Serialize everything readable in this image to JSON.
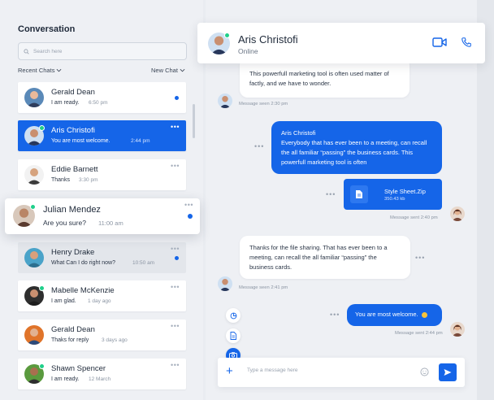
{
  "sidebar": {
    "title": "Conversation",
    "search_placeholder": "Search here",
    "filter_left": "Recent Chats",
    "filter_right": "New Chat",
    "chats": [
      {
        "name": "Gerald Dean",
        "message": "I am ready.",
        "time": "6:50 pm",
        "unread": true
      },
      {
        "name": "Aris Christofi",
        "message": "You are most welcome.",
        "time": "2:44 pm",
        "unread": false
      },
      {
        "name": "Eddie Barnett",
        "message": "Thanks",
        "time": "3:30 pm",
        "unread": false
      },
      {
        "name": "Julian Mendez",
        "message": "Are you sure?",
        "time": "11:00 am",
        "unread": true
      },
      {
        "name": "Henry Drake",
        "message": "What Can I do right now?",
        "time": "10:50 am",
        "unread": true
      },
      {
        "name": "Mabelle McKenzie",
        "message": "I am glad.",
        "time": "1 day ago",
        "unread": false
      },
      {
        "name": "Gerald Dean",
        "message": "Thaks for reply",
        "time": "3 days ago",
        "unread": false
      },
      {
        "name": "Shawn Spencer",
        "message": "I am ready.",
        "time": "12 March",
        "unread": false
      }
    ],
    "more_dots": "•••"
  },
  "header": {
    "name": "Aris Christofi",
    "status": "Online"
  },
  "messages": {
    "m1_text": "This powerfull marketing tool is often used matter of factly, and we have to wonder.",
    "m1_meta": "Message seen 2:30 pm",
    "m2_sender": "Aris Christofi",
    "m2_text": "Everybody that has ever been to a meeting, can recall the all familiar “passing” the business cards. This powerfull marketing tool is often",
    "file_name": "Style Sheet.Zip",
    "file_size": "350.43 kb",
    "m3_meta": "Message sent 2:40 pm",
    "m4_text": "Thanks for the file sharing. That has ever been to a meeting, can recall the all familiar “passing” the business cards.",
    "m4_meta": "Message seen 2:41 pm",
    "m5_text": "You are most welcome.",
    "m5_meta": "Message sent 2:44 pm",
    "dots": "•••"
  },
  "composer": {
    "placeholder": "Type a message here",
    "plus": "+"
  },
  "colors": {
    "accent": "#1565e8",
    "online": "#1fcf8a",
    "background": "#eef0f4"
  },
  "icons": [
    "search-icon",
    "chevron-down-icon",
    "video-call-icon",
    "phone-icon",
    "file-icon",
    "pie-chart-icon",
    "document-icon",
    "camera-icon",
    "emoji-icon",
    "send-icon",
    "plus-icon"
  ]
}
